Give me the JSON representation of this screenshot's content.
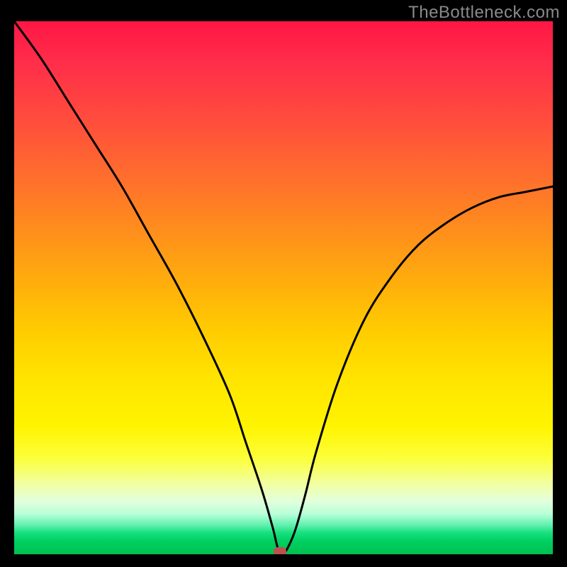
{
  "watermark": "TheBottleneck.com",
  "chart_data": {
    "type": "line",
    "title": "",
    "xlabel": "",
    "ylabel": "",
    "xlim": [
      0,
      100
    ],
    "ylim": [
      0,
      100
    ],
    "grid": false,
    "legend": false,
    "series": [
      {
        "name": "bottleneck_curve",
        "x": [
          0,
          5,
          10,
          15,
          20,
          25,
          30,
          35,
          40,
          43,
          46,
          48,
          49,
          50,
          52,
          54,
          56,
          60,
          65,
          70,
          75,
          80,
          85,
          90,
          95,
          100
        ],
        "y": [
          100,
          93,
          85,
          77,
          69,
          60,
          51,
          41,
          30,
          21,
          12,
          5,
          1,
          0,
          4,
          11,
          19,
          32,
          44,
          52,
          58,
          62,
          65,
          67,
          68,
          69
        ]
      }
    ],
    "marker": {
      "x": 49.3,
      "y": 0.5
    },
    "background_gradient": {
      "stops": [
        {
          "pos": 0.0,
          "color": "#ff1744"
        },
        {
          "pos": 0.5,
          "color": "#ffcc00"
        },
        {
          "pos": 0.82,
          "color": "#fcff3a"
        },
        {
          "pos": 0.95,
          "color": "#16e07e"
        },
        {
          "pos": 1.0,
          "color": "#00c050"
        }
      ]
    }
  }
}
